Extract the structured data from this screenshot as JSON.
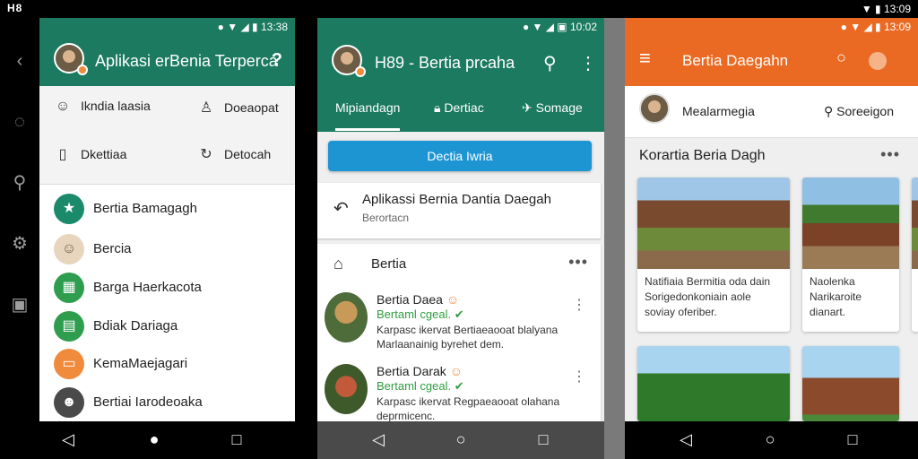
{
  "system": {
    "left_icons": "H8",
    "time_right": "13:09"
  },
  "rail": {
    "items": [
      "back-icon",
      "chat-icon",
      "search-icon",
      "gear-icon",
      "briefcase-icon"
    ]
  },
  "panel1": {
    "status_time": "13:38",
    "title": "Aplikasi erBenia Terperca",
    "help": "?",
    "menu": [
      {
        "label": "Ikndia laasia",
        "icon": "person-icon"
      },
      {
        "label": "Doeaopat",
        "icon": "person-outline-icon"
      },
      {
        "label": "Dkettiaa",
        "icon": "tablet-icon"
      },
      {
        "label": "Detocah",
        "icon": "refresh-icon"
      }
    ],
    "list": [
      {
        "label": "Bertia Bamagagh",
        "color": "#1b8a6b",
        "glyph": "★"
      },
      {
        "label": "Bercia",
        "color": "#e7d6bd",
        "glyph": "☺"
      },
      {
        "label": "Barga Haerkacota",
        "color": "#2e9e4e",
        "glyph": "▦"
      },
      {
        "label": "Bdiak Dariaga",
        "color": "#2e9e4e",
        "glyph": "▤"
      },
      {
        "label": "KemaMaejagari",
        "color": "#f08a3c",
        "glyph": "▭"
      },
      {
        "label": "Bertiai Iarodeoaka",
        "color": "#4a4a4a",
        "glyph": "☻"
      }
    ]
  },
  "panel2": {
    "status_time": "10:02",
    "title": "H89 - Bertia prcaha",
    "tabs": [
      "Mipiandagn",
      "Dertiac",
      "Somage"
    ],
    "active_tab": 0,
    "button": "Dectia Iwria",
    "news_card": {
      "title": "Aplikassi Bernia Dantia Daegah",
      "subtitle": "Berortacn"
    },
    "section": "Bertia",
    "feed": [
      {
        "name": "Bertia Daea",
        "status": "Bertaml cgeal.",
        "text": "Karpasc ikervat Bertiaeaooat blalyana Marlaanainig byrehet dem."
      },
      {
        "name": "Bertia Darak",
        "status": "Bertaml cgeal.",
        "text": "Karpasc ikervat Regpaeaooat olahana deprmicenc."
      }
    ]
  },
  "panel3": {
    "status_time": "13:09",
    "title": "Bertia Daegahn",
    "sub": {
      "name": "Mealarmegia",
      "search": "Soreeigon"
    },
    "section": "Korartia Beria Dagh",
    "cards": [
      {
        "caption": "Natifiaia Bermitia oda dain Sorigedonkoniain aole soviay oferiber."
      },
      {
        "caption": "Naolenka Narikaroite dianart."
      },
      {
        "caption": ""
      },
      {
        "caption": ""
      }
    ]
  }
}
